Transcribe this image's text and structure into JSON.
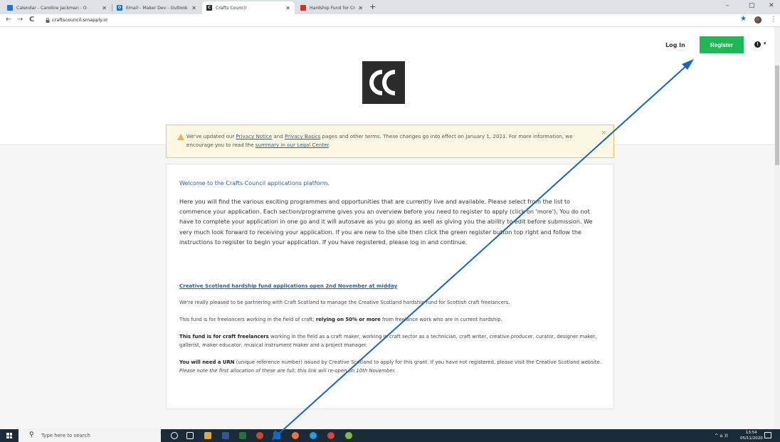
{
  "browser": {
    "tabs": [
      {
        "title": "Calendar - Caroline Jackman - O",
        "favicon_color": "#1a73e8"
      },
      {
        "title": "Email - Maker Dev - Outlook",
        "favicon_color": "#0078d4"
      },
      {
        "title": "Crafts Council",
        "favicon_color": "#2b2b2b"
      },
      {
        "title": "Hardship Fund for Creative Freel",
        "favicon_color": "#d93025"
      }
    ],
    "new_tab": "+",
    "url": "craftscouncil.smapply.io",
    "back": "←",
    "forward": "→",
    "reload": "C",
    "minimize": "–",
    "maximize": "▢",
    "close": "✕",
    "menu": "⋮"
  },
  "header": {
    "login": "Log In",
    "register": "Register",
    "info": "!",
    "caret": "▾",
    "site_name": "Crafts Council"
  },
  "banner": {
    "text_1": "We've updated our ",
    "link_privacy_notice": "Privacy Notice",
    "text_2": " and ",
    "link_privacy_basics": "Privacy Basics",
    "text_3": " pages and other terms. These changes go into effect on January 1, 2021. For more information, we encourage you to read the ",
    "link_summary": "summary in our Legal Center",
    "text_4": ".",
    "close": "×"
  },
  "content": {
    "welcome": "Welcome to the Crafts Council applications platform.",
    "intro": "Here you will find the various exciting programmes and opportunities that are currently live and available. Please select from the list to commence your application.  Each section/programme gives you an overview before you need to register to apply (click on 'more'). You do not have to complete your application in one go and it will autosave as you go along as well as giving you the ability to edit before submission.  We very much look forward to receiving your application.  If you are new to the site then click the green register button top right and follow the instructions to register to begin your application.  If you have registered, please log in and continue.",
    "section_title": "Creative Scotland hardship fund applications open 2nd November at midday",
    "p1": "We're really pleased to be partnering with Craft Scotland to manage the Creative Scotland hardship fund for Scottish craft freelancers.",
    "p2_a": "This fund is for freelancers working in the field of craft; ",
    "p2_b": "relying on 50% or more",
    "p2_c": " from freelance work who are in current hardship.",
    "p3_a": "This fund is for craft freelancers",
    "p3_b": " working in the field as a craft maker, working in craft sector as a technician, craft writer, creative producer, curator, designer maker, gallerist, maker educator, musical instrument maker and a project manager.",
    "p4_a": "You will need a URN",
    "p4_b": " (unique reference number) issued by Creative Scotland to apply for this grant.  If you have not registered, please visit the Creative Scotland website.  ",
    "p4_c": "Please note the first allocation of these are full; this link will re-open on 10th November."
  },
  "taskbar": {
    "search_placeholder": "Type here to search",
    "time": "13:54",
    "date": "05/11/2020",
    "tray": "^ ⌂ ))"
  },
  "colors": {
    "register_green": "#1eb854",
    "link_blue": "#2a6496",
    "arrow_blue": "#1565c0",
    "banner_bg": "#fcf8e3"
  }
}
